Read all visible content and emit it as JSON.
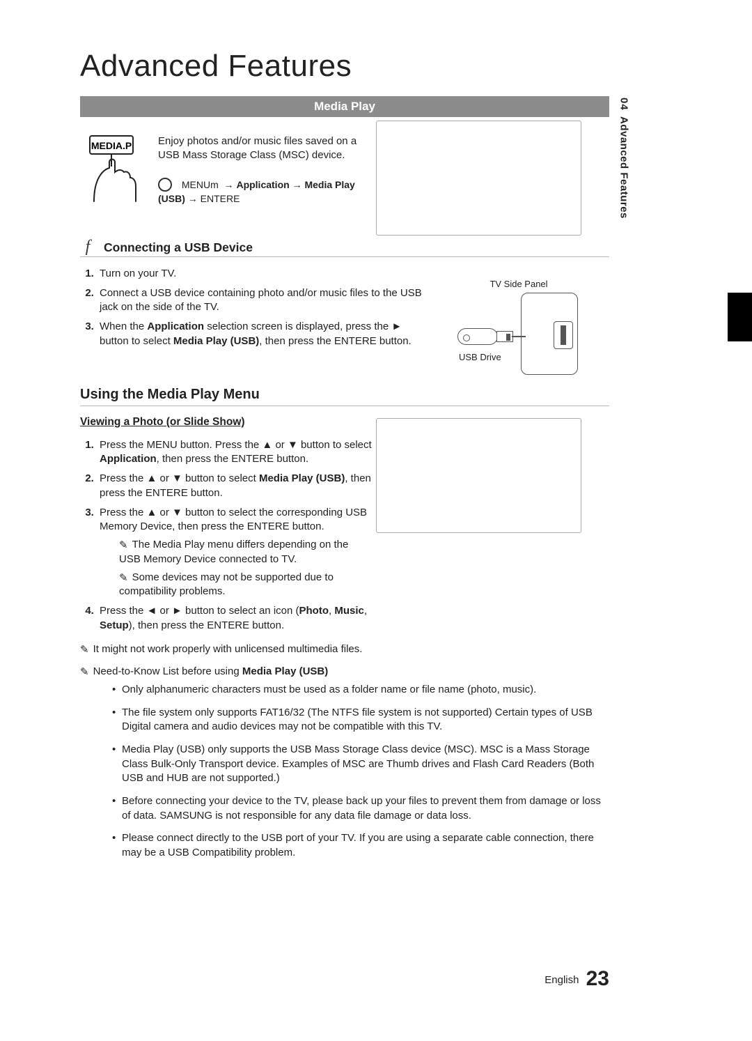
{
  "sidebar": {
    "chapter": "04",
    "label": "Advanced Features"
  },
  "title": "Advanced Features",
  "band": "Media Play",
  "intro": {
    "text": "Enjoy photos and/or music files saved on a USB Mass Storage Class (MSC) device.",
    "path_pre": "MENUm",
    "path_app": "Application",
    "path_mp": "Media Play (USB)",
    "path_enter": "ENTERE",
    "remote_label": "MEDIA.P"
  },
  "sec1": {
    "heading": "Connecting a USB Device",
    "s1": "Turn on your TV.",
    "s2": "Connect a USB device containing photo and/or music files to the USB jack on the side of the TV.",
    "s3a": "When the ",
    "s3b": "Application",
    "s3c": " selection screen is displayed, press the ► button to select ",
    "s3d": "Media Play (USB)",
    "s3e": ", then press the ENTERE   button."
  },
  "panel": {
    "caption": "TV Side Panel",
    "usb": "USB Drive"
  },
  "using": "Using the Media Play Menu",
  "view": {
    "heading": "Viewing a Photo (or Slide Show)",
    "s1a": "Press the MENU button. Press the ▲ or ▼ button to select ",
    "s1b": "Application",
    "s1c": ", then press the ENTERE   button.",
    "s2a": "Press the ▲ or ▼ button to select ",
    "s2b": "Media Play (USB)",
    "s2c": ", then press the ENTERE   button.",
    "s3": "Press the ▲ or ▼ button to select the corresponding USB Memory Device, then press the ENTERE   button.",
    "n3a": "The Media Play menu differs depending on the USB Memory Device connected to TV.",
    "n3b": "Some devices may not be supported due to compatibility problems.",
    "s4a": "Press the ◄ or ► button to select an icon (",
    "s4b": "Photo",
    "s4c": ", ",
    "s4d": "Music",
    "s4e": ", ",
    "s4f": "Setup",
    "s4g": "), then press the ENTERE   button."
  },
  "note1": "It might not work properly with unlicensed multimedia files.",
  "ntk": {
    "lead_a": "Need-to-Know List before using ",
    "lead_b": "Media Play (USB)",
    "i1": "Only alphanumeric characters must be used as a folder name or file name (photo, music).",
    "i2": "The file system only supports FAT16/32 (The NTFS file system is not supported) Certain types of USB Digital camera and audio devices may not be compatible with this TV.",
    "i3": "Media Play (USB) only supports the USB Mass Storage Class device (MSC). MSC is a Mass Storage Class Bulk-Only Transport device. Examples of MSC are Thumb drives and Flash Card Readers (Both USB and HUB are not supported.)",
    "i4": "Before connecting your device to the TV, please back up your files to prevent them from damage or loss of data. SAMSUNG is not responsible for any data file damage or data loss.",
    "i5": "Please connect directly to the USB port of your TV. If you are using a separate cable connection, there may be a USB Compatibility problem."
  },
  "footer": {
    "lang": "English",
    "page": "23"
  }
}
